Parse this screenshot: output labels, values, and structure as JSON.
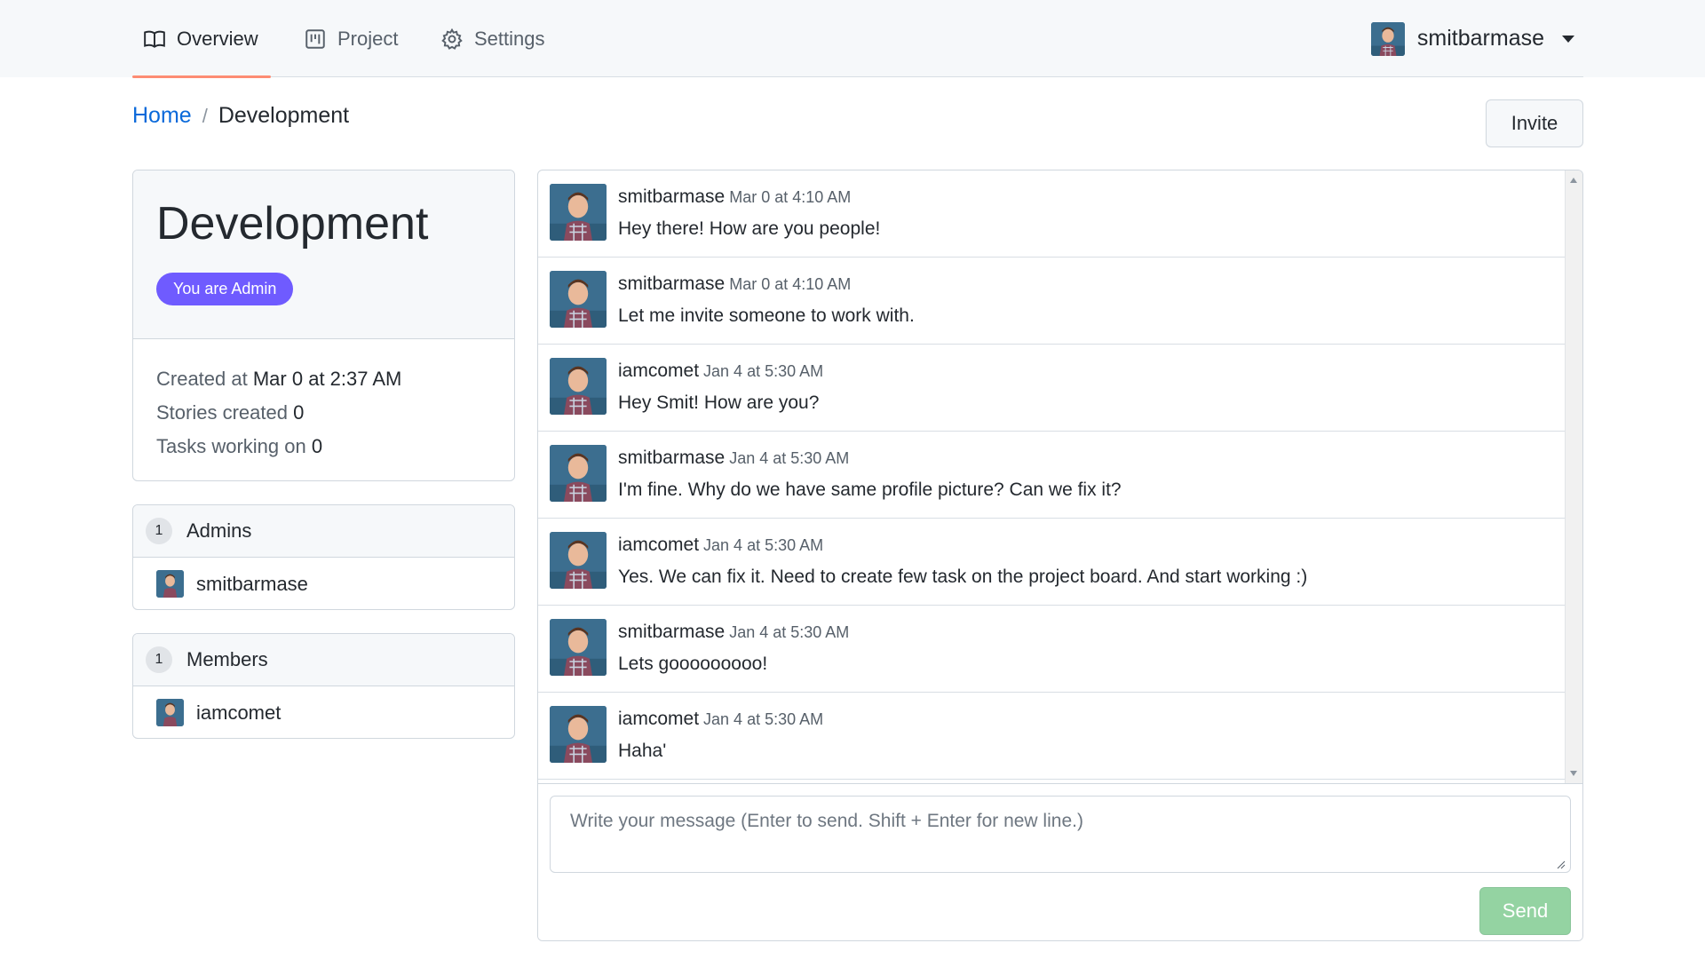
{
  "nav": {
    "tabs": [
      {
        "label": "Overview",
        "icon": "book-icon",
        "active": true
      },
      {
        "label": "Project",
        "icon": "project-board-icon",
        "active": false
      },
      {
        "label": "Settings",
        "icon": "gear-icon",
        "active": false
      }
    ],
    "user": {
      "name": "smitbarmase",
      "icon": "chevron-down-icon"
    }
  },
  "breadcrumb": {
    "home": "Home",
    "separator": "/",
    "current": "Development"
  },
  "invite_label": "Invite",
  "team": {
    "title": "Development",
    "badge": "You are Admin",
    "created_label": "Created at",
    "created_value": "Mar 0 at 2:37 AM",
    "stories_label": "Stories created",
    "stories_value": "0",
    "tasks_label": "Tasks working on",
    "tasks_value": "0"
  },
  "admins": {
    "count": "1",
    "label": "Admins",
    "items": [
      "smitbarmase"
    ]
  },
  "members": {
    "count": "1",
    "label": "Members",
    "items": [
      "iamcomet"
    ]
  },
  "messages": [
    {
      "user": "smitbarmase",
      "time": "Mar 0 at 4:10 AM",
      "text": "Hey there! How are you people!"
    },
    {
      "user": "smitbarmase",
      "time": "Mar 0 at 4:10 AM",
      "text": "Let me invite someone to work with."
    },
    {
      "user": "iamcomet",
      "time": "Jan 4 at 5:30 AM",
      "text": "Hey Smit! How are you?"
    },
    {
      "user": "smitbarmase",
      "time": "Jan 4 at 5:30 AM",
      "text": "I'm fine. Why do we have same profile picture? Can we fix it?"
    },
    {
      "user": "iamcomet",
      "time": "Jan 4 at 5:30 AM",
      "text": "Yes. We can fix it. Need to create few task on the project board. And start working :)"
    },
    {
      "user": "smitbarmase",
      "time": "Jan 4 at 5:30 AM",
      "text": "Lets gooooooooo!"
    },
    {
      "user": "iamcomet",
      "time": "Jan 4 at 5:30 AM",
      "text": "Haha'"
    }
  ],
  "composer": {
    "placeholder": "Write your message (Enter to send. Shift + Enter for new line.)",
    "value": "",
    "send_label": "Send"
  },
  "colors": {
    "accent_tab_underline": "#fd8c73",
    "link": "#0969da",
    "admin_badge": "#6f5bff",
    "send_button_disabled": "#94d3a2"
  }
}
